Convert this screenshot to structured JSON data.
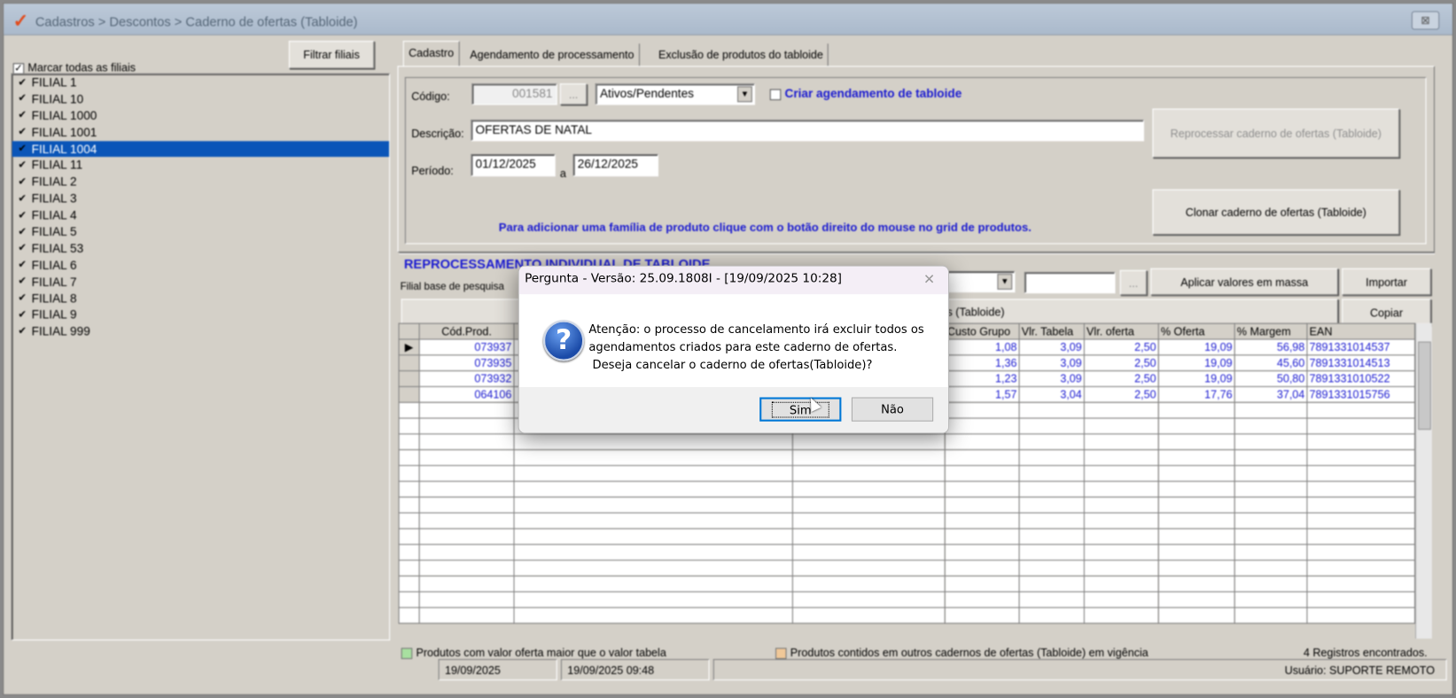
{
  "window": {
    "title": "Cadastros > Descontos > Caderno de ofertas (Tabloide)",
    "close": "⊠"
  },
  "left": {
    "filter_button": "Filtrar filiais",
    "mark_all": "Marcar todas as filiais",
    "branches": [
      "FILIAL 1",
      "FILIAL 10",
      "FILIAL 1000",
      "FILIAL 1001",
      "FILIAL 1004",
      "FILIAL 11",
      "FILIAL 2",
      "FILIAL 3",
      "FILIAL 4",
      "FILIAL 5",
      "FILIAL 53",
      "FILIAL 6",
      "FILIAL 7",
      "FILIAL 8",
      "FILIAL 9",
      "FILIAL 999"
    ],
    "selected": "FILIAL 1004"
  },
  "tabs": [
    "Cadastro",
    "Agendamento de processamento",
    "Exclusão de produtos do tabloide"
  ],
  "form": {
    "codigo_label": "Código:",
    "codigo": "001581",
    "ellipsis": "...",
    "status": "Ativos/Pendentes",
    "criar_agendamento": "Criar agendamento de tabloide",
    "descricao_label": "Descrição:",
    "descricao": "OFERTAS DE NATAL",
    "periodo_label": "Período:",
    "inicio": "01/12/2025",
    "a": "a",
    "fim": "26/12/2025",
    "reprocessar": "Reprocessar caderno de ofertas (Tabloide)",
    "clonar": "Clonar caderno de ofertas (Tabloide)",
    "hint": "Para adicionar uma família de produto clique com o botão direito do  mouse no grid de produtos."
  },
  "reproc": {
    "title": "REPROCESSAMENTO INDIVIDUAL DE TABLOIDE",
    "filial_label": "Filial base de pesquisa",
    "aplicar": "Aplicar valores em massa",
    "importar": "Importar",
    "copiar": "Copiar",
    "reprocessar_partial": "as (Tabloide)"
  },
  "grid": {
    "headers": [
      "Cód.Prod.",
      "",
      "",
      "Custo Grupo",
      "Vlr. Tabela",
      "Vlr. oferta",
      "% Oferta",
      "% Margem",
      "EAN"
    ],
    "rows": [
      [
        "073937",
        "",
        "",
        "1,08",
        "3,09",
        "2,50",
        "19,09",
        "56,98",
        "7891331014537"
      ],
      [
        "073935",
        "",
        "",
        "1,36",
        "3,09",
        "2,50",
        "19,09",
        "45,60",
        "7891331014513"
      ],
      [
        "073932",
        "",
        "",
        "1,23",
        "3,09",
        "2,50",
        "19,09",
        "50,80",
        "7891331010522"
      ],
      [
        "064106",
        "",
        "",
        "1,57",
        "3,04",
        "2,50",
        "17,76",
        "37,04",
        "7891331015756"
      ]
    ]
  },
  "legend": {
    "green": "Produtos com valor oferta maior que o valor tabela",
    "orange": "Produtos contidos em outros cadernos de ofertas (Tabloide) em vigência",
    "count": "4 Registros encontrados.",
    "green_color": "#a8e0a0",
    "orange_color": "#f0c898"
  },
  "status": {
    "date": "19/09/2025",
    "datetime": "19/09/2025 09:48",
    "user": "Usuário: SUPORTE REMOTO"
  },
  "dialog": {
    "title": "Pergunta - Versão: 25.09.1808I - [19/09/2025 10:28]",
    "message": "Atenção: o processo de cancelamento irá excluir todos os\nagendamentos criados para este caderno de ofertas.\n Deseja cancelar o caderno de ofertas(Tabloide)?",
    "yes": "Sim",
    "no": "Não",
    "close": "✕",
    "icon": "?"
  }
}
